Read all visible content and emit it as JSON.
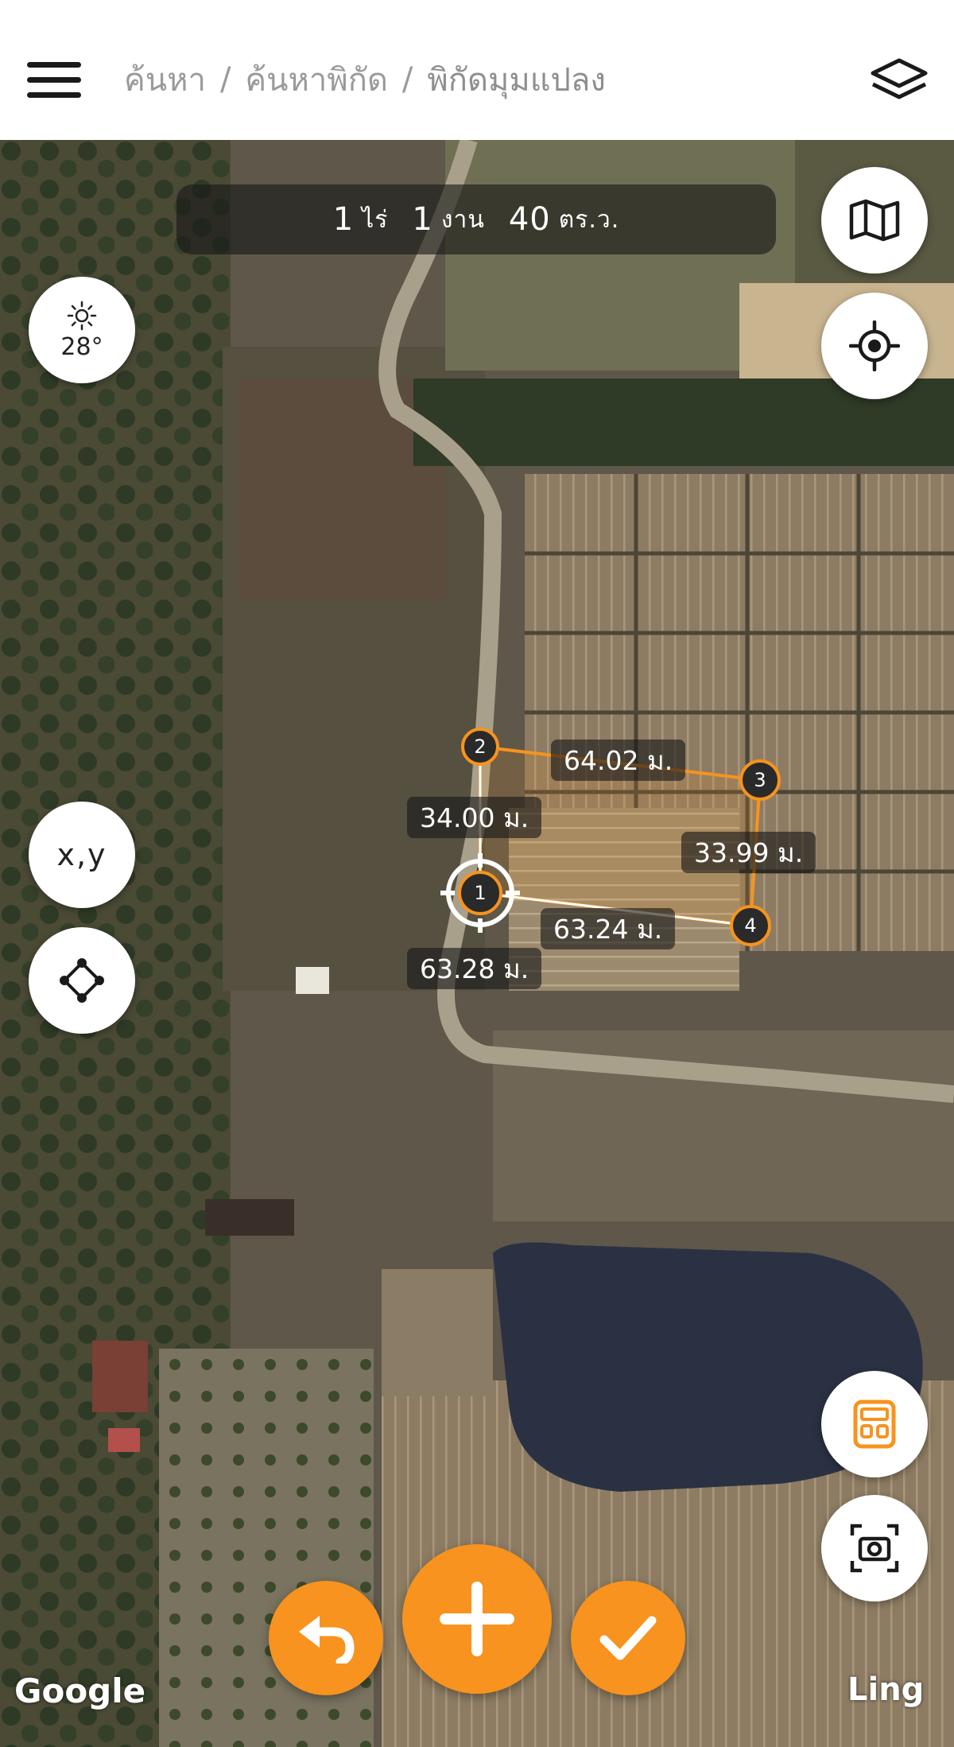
{
  "header": {
    "breadcrumb": [
      "ค้นหา",
      "ค้นหาพิกัด",
      "พิกัดมุมแปลง"
    ],
    "separator": "/"
  },
  "area": {
    "rai_value": "1",
    "rai_unit": "ไร่",
    "ngan_value": "1",
    "ngan_unit": "งาน",
    "wa_value": "40",
    "wa_unit": "ตร.ว."
  },
  "weather": {
    "icon": "sun-icon",
    "temperature": "28°"
  },
  "controls": {
    "xy_label": "x,y",
    "map_type_icon": "map-icon",
    "locate_icon": "crosshair-icon",
    "polygon_icon": "polygon-icon",
    "calculator_icon": "calculator-icon",
    "screenshot_icon": "camera-icon",
    "undo_icon": "undo-icon",
    "add_icon": "plus-icon",
    "confirm_icon": "check-icon"
  },
  "plot": {
    "vertices": [
      "1",
      "2",
      "3",
      "4"
    ],
    "segments": {
      "s12": "34.00 ม.",
      "s23": "64.02 ม.",
      "s34": "33.99 ม.",
      "s41": "63.24 ม.",
      "s_alt": "63.28 ม."
    }
  },
  "attribution": {
    "google": "Google",
    "ling": "Ling"
  },
  "colors": {
    "accent": "#f7931e",
    "pill_bg": "rgba(25,25,25,0.62)"
  }
}
